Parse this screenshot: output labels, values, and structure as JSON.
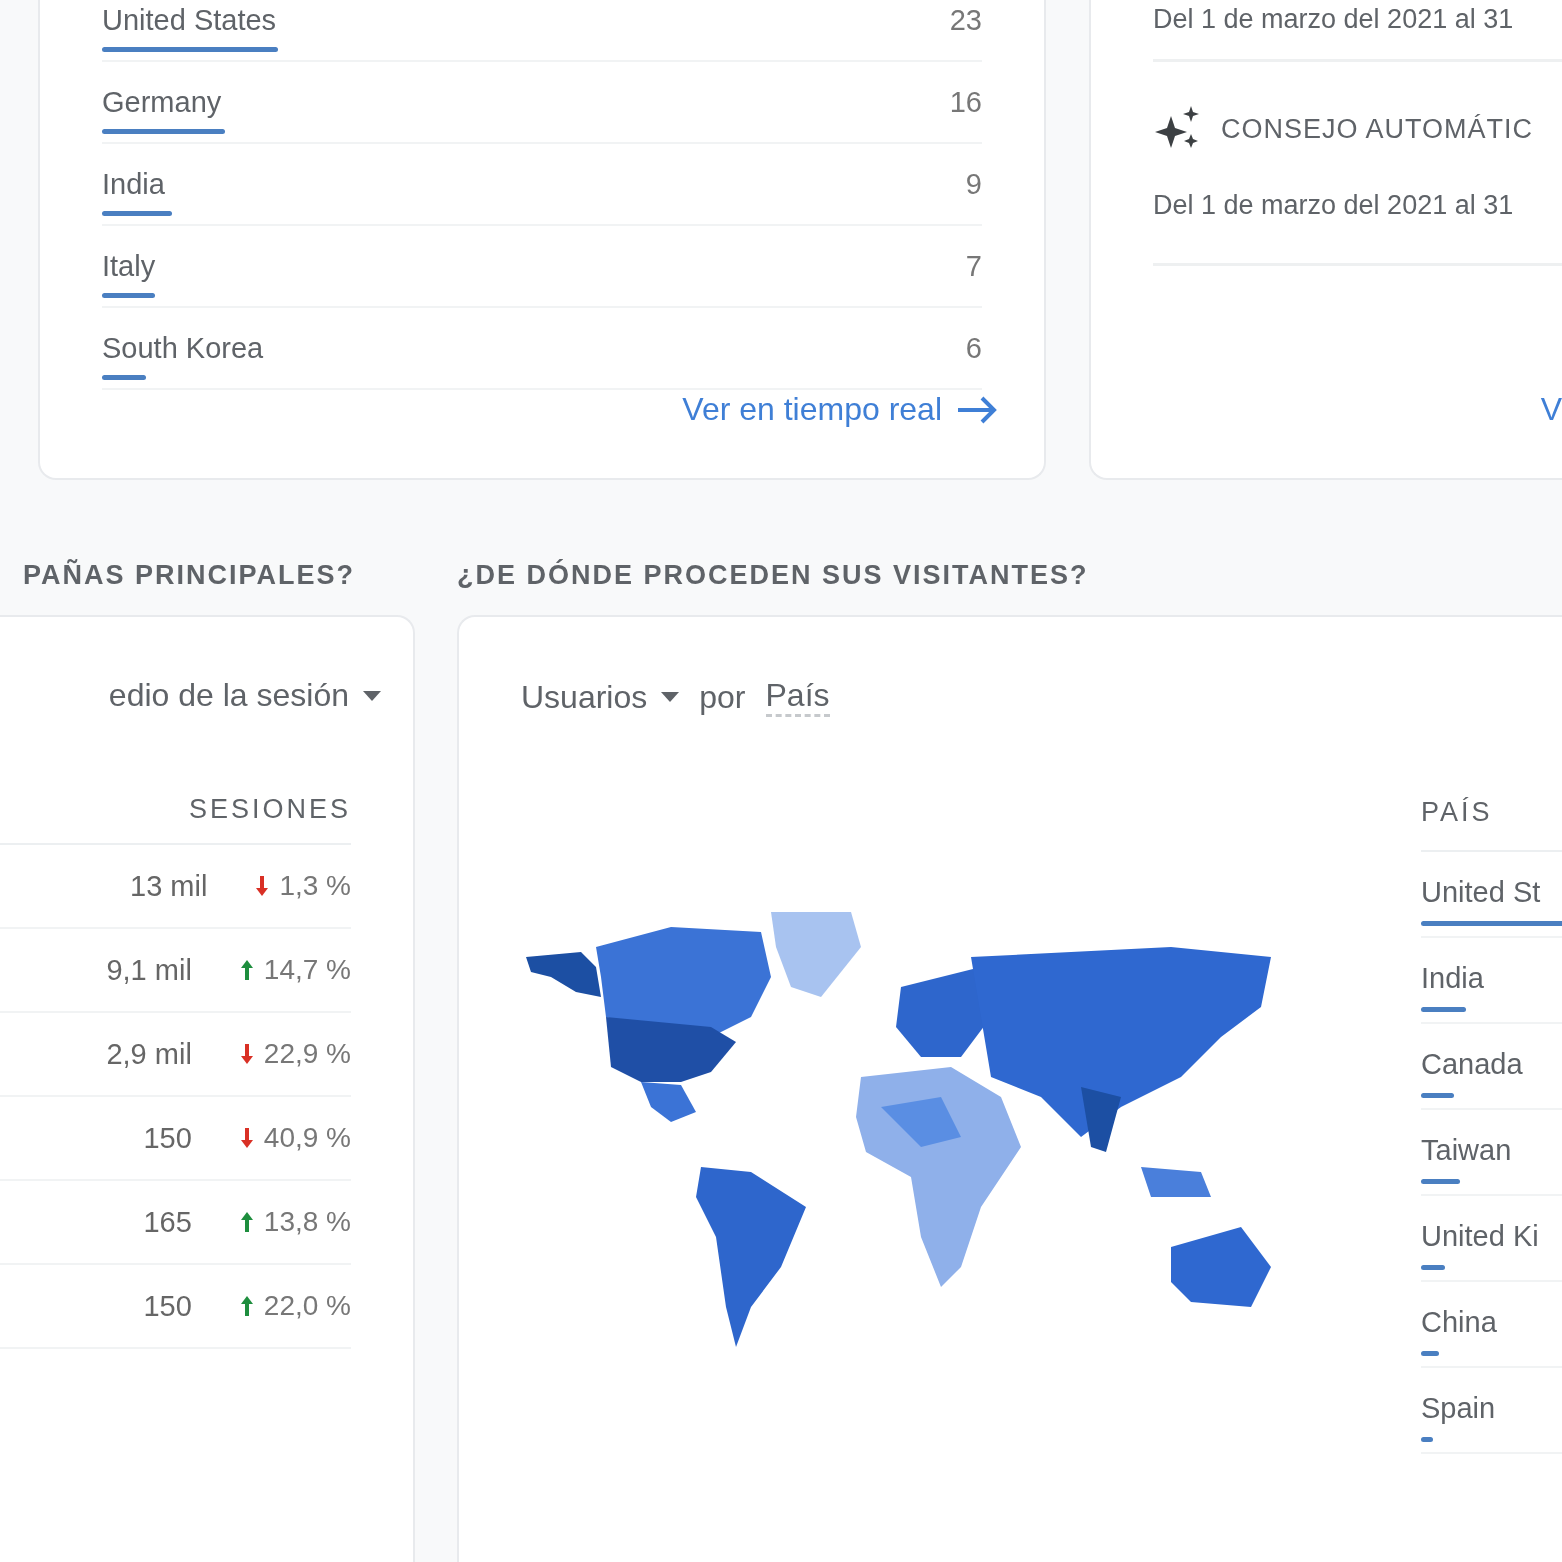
{
  "top_countries": {
    "rows": [
      {
        "country": "United States",
        "users": "23",
        "level": 0.2
      },
      {
        "country": "Germany",
        "users": "16",
        "level": 0.14
      },
      {
        "country": "India",
        "users": "9",
        "level": 0.08
      },
      {
        "country": "Italy",
        "users": "7",
        "level": 0.06
      },
      {
        "country": "South Korea",
        "users": "6",
        "level": 0.05
      }
    ],
    "link": "Ver en tiempo real"
  },
  "insights": {
    "date_range_top": "Del 1 de marzo del 2021 al 31",
    "insight_label": "CONSEJO AUTOMÁTIC",
    "date_range": "Del 1 de marzo del 2021 al 31",
    "link": "V"
  },
  "campaigns": {
    "heading": "PAÑAS PRINCIPALES?",
    "selector": "edio de la sesión",
    "column": "SESIONES",
    "rows": [
      {
        "sessions": "13 mil",
        "increase": false,
        "change": "1,3 %"
      },
      {
        "sessions": "9,1 mil",
        "increase": true,
        "change": "14,7 %"
      },
      {
        "sessions": "2,9 mil",
        "increase": false,
        "change": "22,9 %"
      },
      {
        "sessions": "150",
        "increase": false,
        "change": "40,9 %"
      },
      {
        "sessions": "165",
        "increase": true,
        "change": "13,8 %"
      },
      {
        "sessions": "150",
        "increase": true,
        "change": "22,0 %"
      }
    ]
  },
  "visitors": {
    "heading": "¿DE DÓNDE PROCEDEN SUS VISITANTES?",
    "metric": "Usuarios",
    "by": "por",
    "dimension": "País",
    "column": "PAÍS",
    "rows": [
      {
        "country": "United St",
        "level": 0.5
      },
      {
        "country": "India",
        "level": 0.15
      },
      {
        "country": "Canada",
        "level": 0.11
      },
      {
        "country": "Taiwan",
        "level": 0.13
      },
      {
        "country": "United Ki",
        "level": 0.08
      },
      {
        "country": "China",
        "level": 0.06
      },
      {
        "country": "Spain",
        "level": 0.04
      }
    ]
  }
}
